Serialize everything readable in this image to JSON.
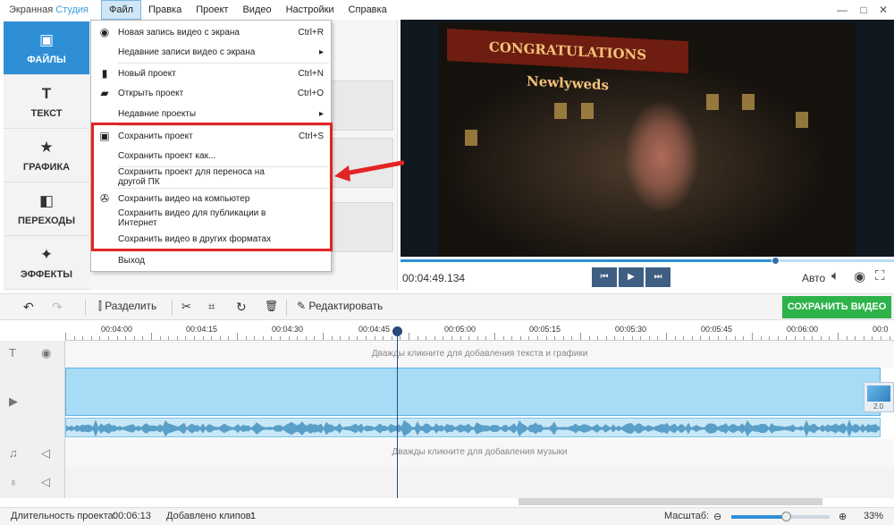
{
  "app": {
    "title_main": "Экранная",
    "title_accent": "Студия"
  },
  "menu": [
    "Файл",
    "Правка",
    "Проект",
    "Видео",
    "Настройки",
    "Справка"
  ],
  "window_controls": [
    "—",
    "□",
    "✕"
  ],
  "sidebar": [
    {
      "label": "ФАЙЛЫ",
      "icon": "image-icon",
      "active": true
    },
    {
      "label": "ТЕКСТ",
      "icon": "text-icon"
    },
    {
      "label": "ГРАФИКА",
      "icon": "star-icon"
    },
    {
      "label": "ПЕРЕХОДЫ",
      "icon": "transition-icon"
    },
    {
      "label": "ЭФФЕКТЫ",
      "icon": "magic-wand-icon"
    }
  ],
  "file_menu": {
    "items": [
      {
        "label": "Новая запись видео с экрана",
        "shortcut": "Ctrl+R",
        "icon": "record-icon"
      },
      {
        "label": "Недавние записи видео с экрана",
        "shortcut": "▸",
        "icon": ""
      },
      {
        "label": "Новый проект",
        "shortcut": "Ctrl+N",
        "icon": "new-file-icon"
      },
      {
        "label": "Открыть проект",
        "shortcut": "Ctrl+O",
        "icon": "folder-icon"
      },
      {
        "label": "Недавние проекты",
        "shortcut": "▸",
        "icon": ""
      },
      {
        "label": "Сохранить проект",
        "shortcut": "Ctrl+S",
        "icon": "floppy-icon"
      },
      {
        "label": "Сохранить проект как...",
        "shortcut": "",
        "icon": ""
      },
      {
        "label": "Сохранить проект для переноса на другой ПК",
        "shortcut": "",
        "icon": ""
      },
      {
        "label": "Сохранить видео на компьютер",
        "shortcut": "",
        "icon": "film-reel-icon"
      },
      {
        "label": "Сохранить видео для публикации в Интернет",
        "shortcut": "",
        "icon": ""
      },
      {
        "label": "Сохранить видео в других форматах",
        "shortcut": "",
        "icon": ""
      },
      {
        "label": "Выход",
        "shortcut": "",
        "icon": ""
      }
    ]
  },
  "preview": {
    "banner": "CONGRATULATIONS Newlyweds",
    "timecode": "00:04:49.134",
    "quality": "Авто",
    "progress": 0.76
  },
  "toolbar": {
    "split": "Разделить",
    "edit": "Редактировать",
    "save_video": "СОХРАНИТЬ ВИДЕО"
  },
  "ruler": [
    "00:04:00",
    "00:04:15",
    "00:04:30",
    "00:04:45",
    "00:05:00",
    "00:05:15",
    "00:05:30",
    "00:05:45",
    "00:06:00",
    "00:0"
  ],
  "tracks": {
    "text_hint": "Дважды кликните для добавления текста и графики",
    "music_hint": "Дважды кликните для добавления музыки",
    "clip_duration": "2.0"
  },
  "status": {
    "duration_label": "Длительность проекта:",
    "duration_value": "00:06:13",
    "clips_label": "Добавлено клипов:",
    "clips_value": "1",
    "zoom_label": "Масштаб:",
    "zoom_value": "33%",
    "zoom_level": 0.55
  },
  "colors": {
    "accent": "#2f8fd6",
    "save_green": "#2db34a",
    "highlight_red": "#e32424"
  }
}
